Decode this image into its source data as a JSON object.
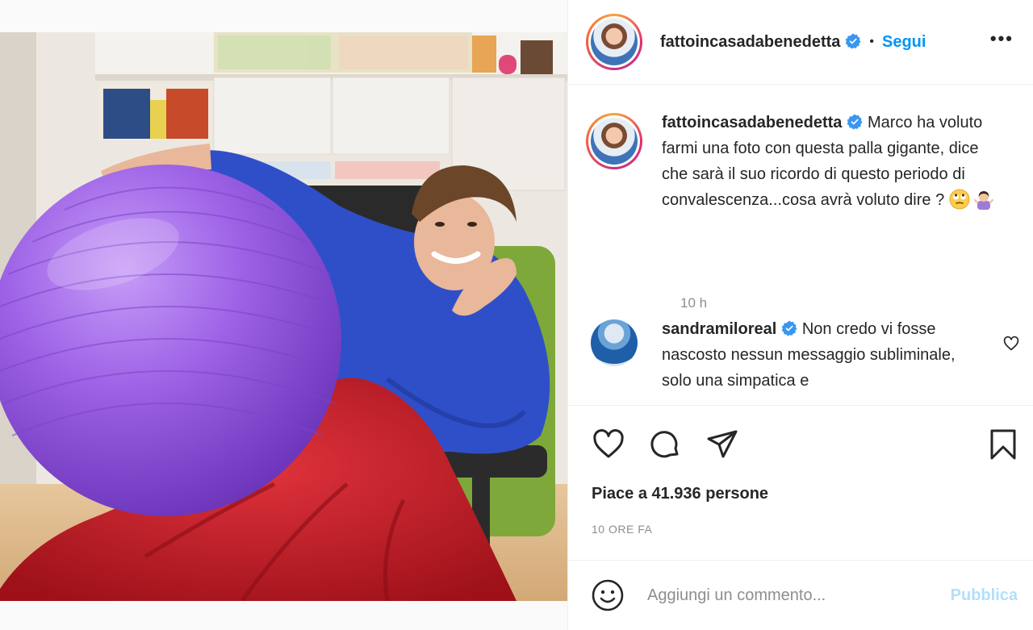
{
  "header": {
    "username": "fattoincasadabenedetta",
    "separator": "•",
    "follow_label": "Segui",
    "more_label": "•••"
  },
  "caption": {
    "username": "fattoincasadabenedetta",
    "text": "Marco ha voluto farmi una foto con questa palla gigante, dice che sarà il suo ricordo di questo periodo di convalescenza...cosa avrà voluto dire ?",
    "emojis": [
      "face-with-rolling-eyes",
      "woman-shrugging"
    ],
    "time": "10 h"
  },
  "comments": [
    {
      "username": "sandramiloreal",
      "text": "Non credo vi fosse nascosto nessun messaggio subliminale, solo una simpatica e"
    }
  ],
  "actions": {
    "icons": [
      "heart-icon",
      "comment-icon",
      "share-icon",
      "bookmark-icon"
    ],
    "likes_text": "Piace a 41.936 persone",
    "date": "10 ORE FA"
  },
  "add_comment": {
    "placeholder": "Aggiungi un commento...",
    "publish_label": "Pubblica"
  },
  "colors": {
    "accent": "#0095f6",
    "publish_disabled": "#b2dffc",
    "verified": "#3897f0",
    "ball": "#9b5fe0",
    "blanket": "#c8202a",
    "sweater": "#2f4fc9"
  }
}
